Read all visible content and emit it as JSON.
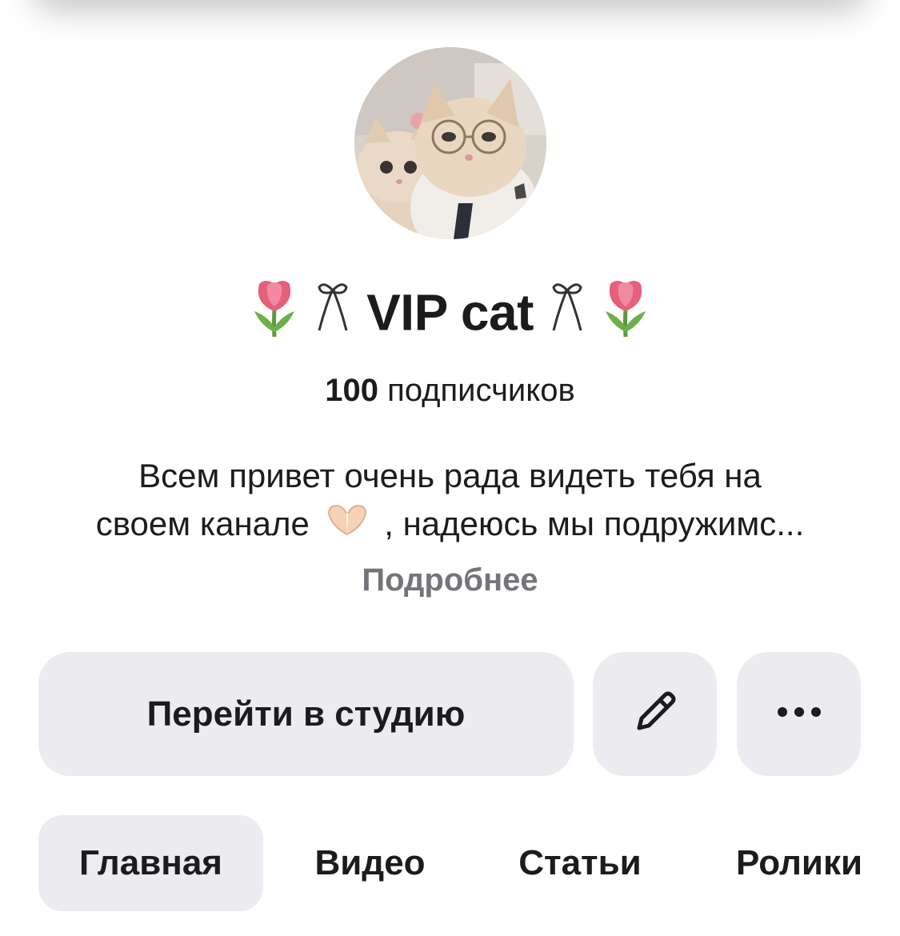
{
  "channel": {
    "title_main": "VIP cat",
    "subscribers_count": "100",
    "subscribers_label": "подписчиков",
    "description_line1": "Всем привет очень рада видеть тебя на",
    "description_line2_a": "своем канале",
    "description_line2_b": ", надеюсь мы подружимс...",
    "more_label": "Подробнее"
  },
  "actions": {
    "studio_label": "Перейти в студию",
    "edit_icon": "pencil-icon",
    "more_icon": "more-dots-icon"
  },
  "tabs": [
    {
      "label": "Главная",
      "active": true
    },
    {
      "label": "Видео",
      "active": false
    },
    {
      "label": "Статьи",
      "active": false
    },
    {
      "label": "Ролики",
      "active": false
    }
  ],
  "colors": {
    "button_bg": "#ebebf0",
    "muted_text": "#74747a",
    "text": "#1c1c1e"
  }
}
